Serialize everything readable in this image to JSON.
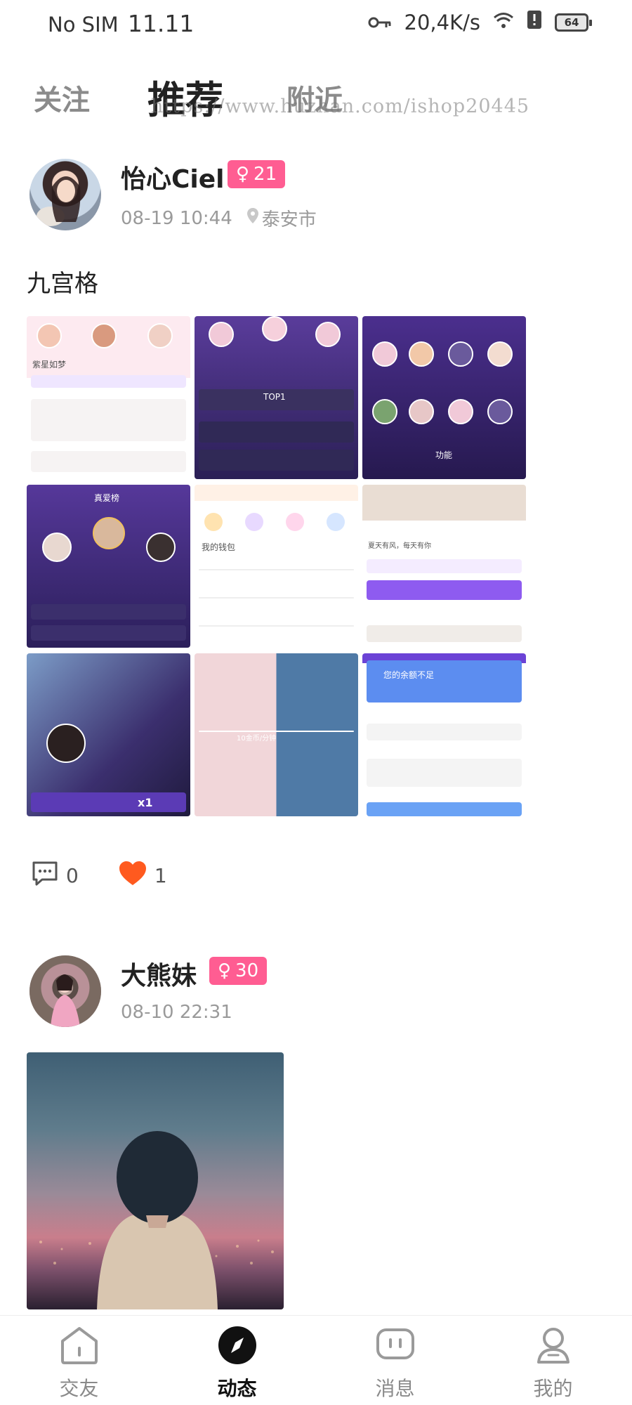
{
  "status_bar": {
    "carrier": "No SIM",
    "time": "11.11",
    "network_speed": "20,4K/s",
    "battery": "64"
  },
  "top_tabs": [
    {
      "label": "关注",
      "active": false
    },
    {
      "label": "推荐",
      "active": true
    },
    {
      "label": "附近",
      "active": false
    }
  ],
  "watermark": "https://www.huzhan.com/ishop20445",
  "posts": [
    {
      "username": "怡心Ciel",
      "gender_symbol": "♀",
      "age": "21",
      "datetime": "08-19 10:44",
      "location": "泰安市",
      "text": "九宫格",
      "comments": "0",
      "likes": "1",
      "grid_labels": [
        "紫星如梦",
        "TOP1",
        "功能",
        "真爱榜",
        "我的钱包",
        "夏天有风，每天有你",
        "x1",
        "10金币/分钟",
        "您的余额不足"
      ]
    },
    {
      "username": "大熊妹",
      "gender_symbol": "♀",
      "age": "30",
      "datetime": "08-10 22:31"
    }
  ],
  "bottom_nav": [
    {
      "label": "交友",
      "icon": "home-icon",
      "active": false
    },
    {
      "label": "动态",
      "icon": "compass-icon",
      "active": true
    },
    {
      "label": "消息",
      "icon": "message-icon",
      "active": false
    },
    {
      "label": "我的",
      "icon": "person-icon",
      "active": false
    }
  ],
  "colors": {
    "accent_pink": "#ff5d92",
    "like_orange": "#ff5a1f",
    "grid_purple": "#3b2a6b"
  }
}
